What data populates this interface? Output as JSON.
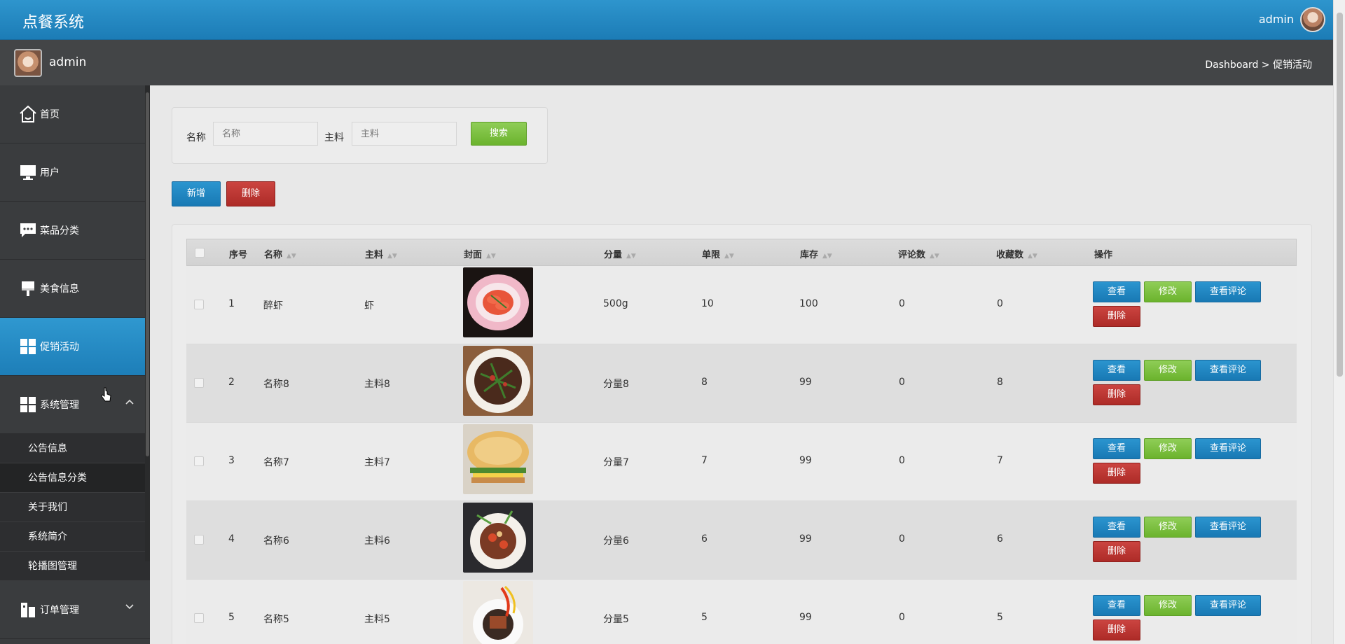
{
  "header": {
    "app_title": "点餐系统",
    "user": "admin"
  },
  "subbar": {
    "user": "admin",
    "breadcrumb": "Dashboard > 促销活动"
  },
  "sidebar": {
    "items": [
      {
        "label": "首页",
        "icon": "home-icon"
      },
      {
        "label": "用户",
        "icon": "monitor-icon"
      },
      {
        "label": "菜品分类",
        "icon": "chat-icon"
      },
      {
        "label": "美食信息",
        "icon": "brush-icon"
      },
      {
        "label": "促销活动",
        "icon": "grid-icon",
        "active": true
      },
      {
        "label": "系统管理",
        "icon": "grid-icon",
        "expanded": true
      }
    ],
    "sub_items": [
      "公告信息",
      "公告信息分类",
      "关于我们",
      "系统简介",
      "轮播图管理"
    ],
    "last_item": {
      "label": "订单管理",
      "icon": "building-icon"
    }
  },
  "search": {
    "name_label": "名称",
    "name_placeholder": "名称",
    "ingredient_label": "主料",
    "ingredient_placeholder": "主料",
    "search_button": "搜索"
  },
  "toolbar": {
    "add_button": "新增",
    "delete_button": "删除"
  },
  "table": {
    "headers": {
      "index": "序号",
      "name": "名称",
      "ingredient": "主料",
      "cover": "封面",
      "portion": "分量",
      "limit": "单限",
      "stock": "库存",
      "comments": "评论数",
      "favorites": "收藏数",
      "actions": "操作"
    },
    "rows": [
      {
        "index": "1",
        "name": "醉虾",
        "ingredient": "虾",
        "portion": "500g",
        "limit": "10",
        "stock": "100",
        "comments": "0",
        "favorites": "0",
        "cover": "shrimp-dish"
      },
      {
        "index": "2",
        "name": "名称8",
        "ingredient": "主料8",
        "portion": "分量8",
        "limit": "8",
        "stock": "99",
        "comments": "0",
        "favorites": "8",
        "cover": "stir-fry-dish"
      },
      {
        "index": "3",
        "name": "名称7",
        "ingredient": "主料7",
        "portion": "分量7",
        "limit": "7",
        "stock": "99",
        "comments": "0",
        "favorites": "7",
        "cover": "pancake-dish"
      },
      {
        "index": "4",
        "name": "名称6",
        "ingredient": "主料6",
        "portion": "分量6",
        "limit": "6",
        "stock": "99",
        "comments": "0",
        "favorites": "6",
        "cover": "lotus-root-dish"
      },
      {
        "index": "5",
        "name": "名称5",
        "ingredient": "主料5",
        "portion": "分量5",
        "limit": "5",
        "stock": "99",
        "comments": "0",
        "favorites": "5",
        "cover": "pork-dish"
      }
    ],
    "actions": {
      "view": "查看",
      "edit": "修改",
      "view_comments": "查看评论",
      "delete": "删除"
    }
  },
  "colors": {
    "primary_blue": "#1c7cb6",
    "green": "#7cbf3f",
    "red": "#b8322e",
    "sidebar": "#3a3c3e"
  }
}
